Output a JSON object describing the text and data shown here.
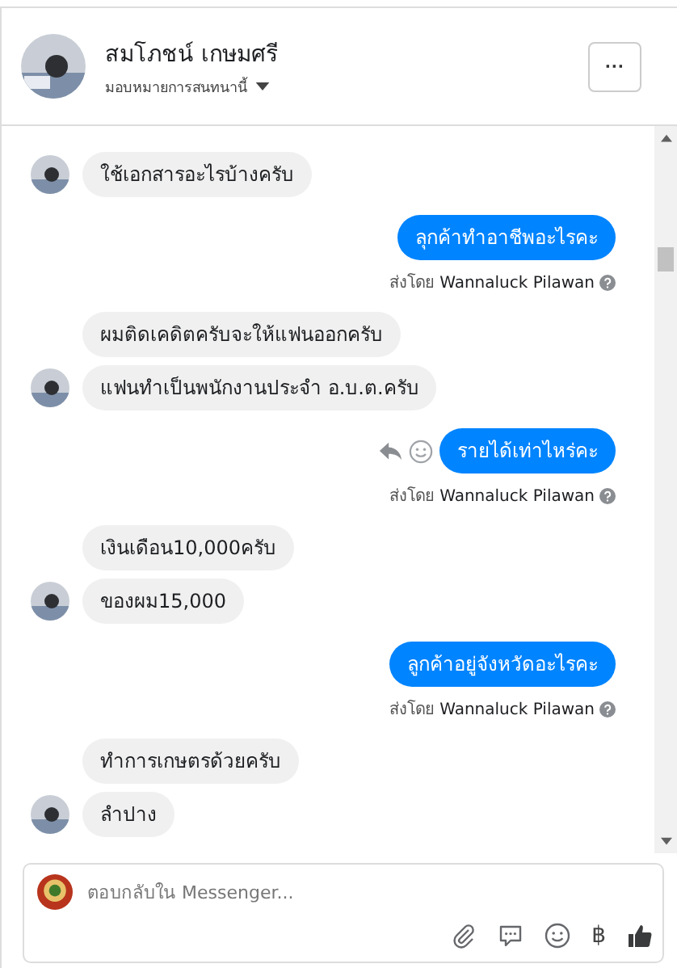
{
  "header": {
    "name": "สมโภชน์ เกษมศรี",
    "assign": "มอบหมายการสนทนานี้",
    "more": "···"
  },
  "thread": [
    {
      "kind": "received",
      "messages": [
        {
          "text": "ใช้เอกสารอะไรบ้างครับ"
        }
      ]
    },
    {
      "kind": "sent",
      "messages": [
        {
          "text": "ลุกค้าทำอาชีพอะไรคะ",
          "hover": false
        }
      ],
      "sent_by": "ส่งโดย",
      "sender": "Wannaluck Pilawan"
    },
    {
      "kind": "received",
      "messages": [
        {
          "text": "ผมติดเคดิตครับจะให้แฟนออกครับ"
        },
        {
          "text": "แฟนทำเป็นพนักงานประจำ อ.บ.ต.ครับ"
        }
      ]
    },
    {
      "kind": "sent",
      "messages": [
        {
          "text": "รายได้เท่าไหร่คะ",
          "hover": true
        }
      ],
      "sent_by": "ส่งโดย",
      "sender": "Wannaluck Pilawan"
    },
    {
      "kind": "received",
      "messages": [
        {
          "text": "เงินเดือน10,000ครับ"
        },
        {
          "text": "ของผม15,000"
        }
      ]
    },
    {
      "kind": "sent",
      "messages": [
        {
          "text": "ลูกค้าอยู่จังหวัดอะไรคะ",
          "hover": false
        }
      ],
      "sent_by": "ส่งโดย",
      "sender": "Wannaluck Pilawan"
    },
    {
      "kind": "received",
      "messages": [
        {
          "text": "ทำการเกษตรด้วยครับ"
        },
        {
          "text": "ลำปาง"
        }
      ]
    }
  ],
  "composer": {
    "placeholder": "ตอบกลับใน Messenger...",
    "currency": "฿"
  }
}
